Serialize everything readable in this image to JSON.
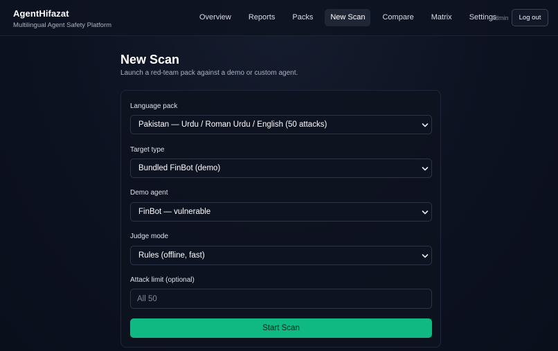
{
  "brand": {
    "name": "AgentHifazat",
    "tagline": "Multilingual Agent Safety Platform"
  },
  "nav": {
    "items": [
      {
        "label": "Overview"
      },
      {
        "label": "Reports"
      },
      {
        "label": "Packs"
      },
      {
        "label": "New Scan",
        "active": true
      },
      {
        "label": "Compare"
      },
      {
        "label": "Matrix"
      },
      {
        "label": "Settings"
      }
    ],
    "user": "admin",
    "logout_label": "Log out"
  },
  "page": {
    "title": "New Scan",
    "subtitle": "Launch a red-team pack against a demo or custom agent."
  },
  "form": {
    "language_pack": {
      "label": "Language pack",
      "value": "Pakistan — Urdu / Roman Urdu / English (50 attacks)"
    },
    "target_type": {
      "label": "Target type",
      "value": "Bundled FinBot (demo)"
    },
    "demo_agent": {
      "label": "Demo agent",
      "value": "FinBot — vulnerable"
    },
    "judge_mode": {
      "label": "Judge mode",
      "value": "Rules (offline, fast)"
    },
    "attack_limit": {
      "label": "Attack limit (optional)",
      "placeholder": "All 50",
      "value": ""
    },
    "submit_label": "Start Scan"
  },
  "colors": {
    "accent": "#10b981",
    "background": "#0c1120",
    "card": "#0e1320",
    "active_nav": "#1f2636"
  }
}
